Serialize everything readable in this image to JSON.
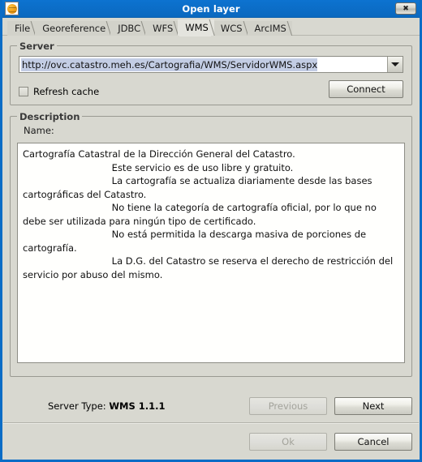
{
  "window": {
    "title": "Open layer",
    "icon": "globe-icon",
    "close_label": "✖",
    "accent_color": "#0b6cc6",
    "background_color": "#d8d8d0"
  },
  "tabs": [
    {
      "label": "File",
      "active": false
    },
    {
      "label": "Georeference",
      "active": false
    },
    {
      "label": "JDBC",
      "active": false
    },
    {
      "label": "WFS",
      "active": false
    },
    {
      "label": "WMS",
      "active": true
    },
    {
      "label": "WCS",
      "active": false
    },
    {
      "label": "ArcIMS",
      "active": false
    }
  ],
  "server": {
    "legend": "Server",
    "url_value": "http://ovc.catastro.meh.es/Cartografia/WMS/ServidorWMS.aspx",
    "url_selected": true,
    "selection_color": "#c3cde4",
    "refresh_cache_label": "Refresh cache",
    "refresh_cache_checked": false,
    "connect_label": "Connect"
  },
  "description": {
    "legend": "Description",
    "name_label": "Name:",
    "text": "Cartografía Catastral de la Dirección General del Catastro.\n                              Este servicio es de uso libre y gratuito.\n                              La cartografía se actualiza diariamente desde las bases cartográficas del Catastro.\n                              No tiene la categoría de cartografía oficial, por lo que no debe ser utilizada para ningún tipo de certificado.\n                              No está permitida la descarga masiva de porciones de cartografía.\n                              La D.G. del Catastro se reserva el derecho de restricción del servicio por abuso del mismo."
  },
  "footer": {
    "server_type_label": "Server Type:",
    "server_type_value": "WMS 1.1.1",
    "previous_label": "Previous",
    "previous_enabled": false,
    "next_label": "Next",
    "next_enabled": true,
    "ok_label": "Ok",
    "ok_enabled": false,
    "cancel_label": "Cancel",
    "cancel_enabled": true
  }
}
